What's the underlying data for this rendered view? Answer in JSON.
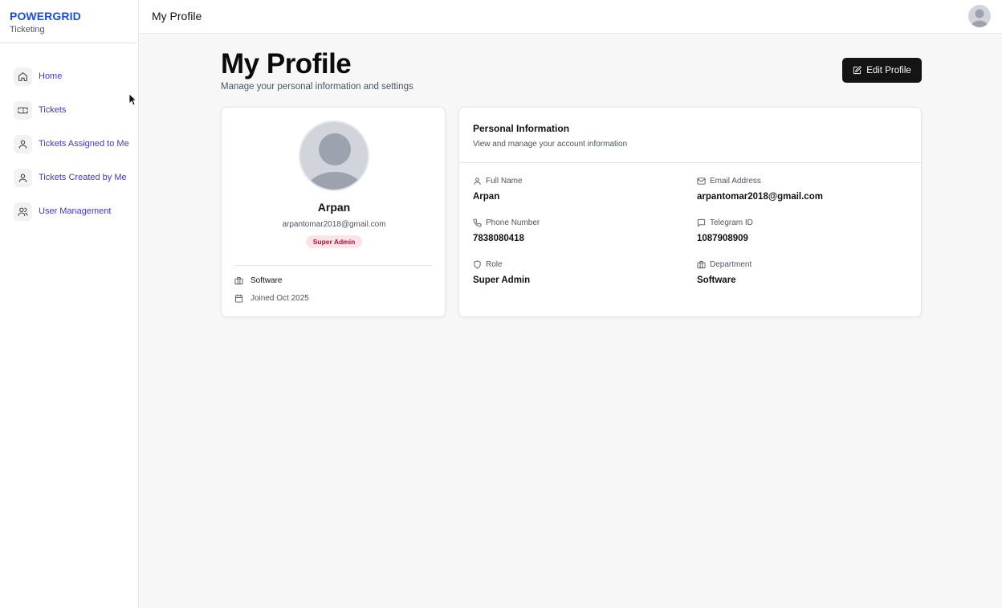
{
  "brand": {
    "name": "POWERGRID",
    "subtitle": "Ticketing"
  },
  "sidebar": {
    "items": [
      {
        "label": "Home",
        "icon": "home-icon"
      },
      {
        "label": "Tickets",
        "icon": "ticket-icon"
      },
      {
        "label": "Tickets Assigned to Me",
        "icon": "user-icon"
      },
      {
        "label": "Tickets Created by Me",
        "icon": "user-icon"
      },
      {
        "label": "User Management",
        "icon": "users-icon"
      }
    ]
  },
  "topbar": {
    "title": "My Profile",
    "avatar_icon": "user-avatar-icon"
  },
  "page": {
    "title": "My Profile",
    "subtitle": "Manage your personal information and settings",
    "edit_button": "Edit Profile"
  },
  "profile_card": {
    "name": "Arpan",
    "email": "arpantomar2018@gmail.com",
    "role_badge": "Super Admin",
    "department": "Software",
    "joined": "Joined Oct 2025"
  },
  "info_card": {
    "title": "Personal Information",
    "subtitle": "View and manage your account information",
    "fields": [
      {
        "label": "Full Name",
        "value": "Arpan",
        "icon": "user-icon"
      },
      {
        "label": "Email Address",
        "value": "arpantomar2018@gmail.com",
        "icon": "mail-icon"
      },
      {
        "label": "Phone Number",
        "value": "7838080418",
        "icon": "phone-icon"
      },
      {
        "label": "Telegram ID",
        "value": "1087908909",
        "icon": "message-icon"
      },
      {
        "label": "Role",
        "value": "Super Admin",
        "icon": "shield-icon"
      },
      {
        "label": "Department",
        "value": "Software",
        "icon": "briefcase-icon"
      }
    ]
  },
  "colors": {
    "brand": "#1d4ed8",
    "nav_text": "#4338ca",
    "button_bg": "#141414",
    "badge_bg": "#fde2e6",
    "badge_text": "#b4123b"
  }
}
